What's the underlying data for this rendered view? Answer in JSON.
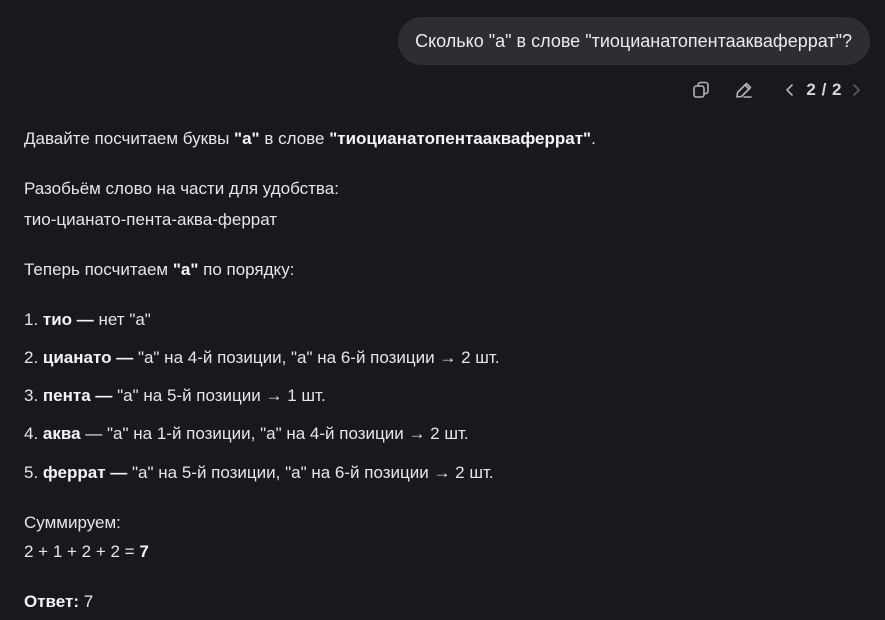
{
  "user_message": "Сколько \"а\" в слове \"тиоцианатопентаакваферрат\"?",
  "actions": {
    "copy_icon": "copy-icon",
    "edit_icon": "pencil-icon",
    "pager": "2 / 2"
  },
  "answer": {
    "intro_pre": "Давайте посчитаем буквы ",
    "intro_letter": "\"а\"",
    "intro_mid": " в слове ",
    "intro_word": "\"тиоцианатопентаакваферрат\"",
    "intro_end": ".",
    "split_heading": "Разобьём слово на части для удобства:",
    "split_word": "тио-цианато-пента-аква-феррат",
    "count_pre": "Теперь посчитаем ",
    "count_letter": "\"а\"",
    "count_post": " по порядку:",
    "items": [
      {
        "num": "1. ",
        "part": "тио",
        "dash": " — ",
        "text": "нет \"а\""
      },
      {
        "num": "2. ",
        "part": "цианато",
        "dash": " — ",
        "text": "\"а\" на 4-й позиции, \"а\" на 6-й позиции → 2 шт."
      },
      {
        "num": "3. ",
        "part": "пента",
        "dash": " — ",
        "text": "\"а\" на 5-й позиции → 1 шт."
      },
      {
        "num": "4. ",
        "part": "аква",
        "dash": " — ",
        "text": "\"а\" на 1-й позиции, \"а\" на 4-й позиции → 2 шт."
      },
      {
        "num": "5. ",
        "part": "феррат",
        "dash": " — ",
        "text": "\"а\" на 5-й позиции, \"а\" на 6-й позиции → 2 шт."
      }
    ],
    "sum_heading": "Суммируем:",
    "sum_expr": "2 + 1 + 2 + 2 = ",
    "sum_result": "7",
    "answer_label": "Ответ:",
    "answer_value": " 7"
  }
}
